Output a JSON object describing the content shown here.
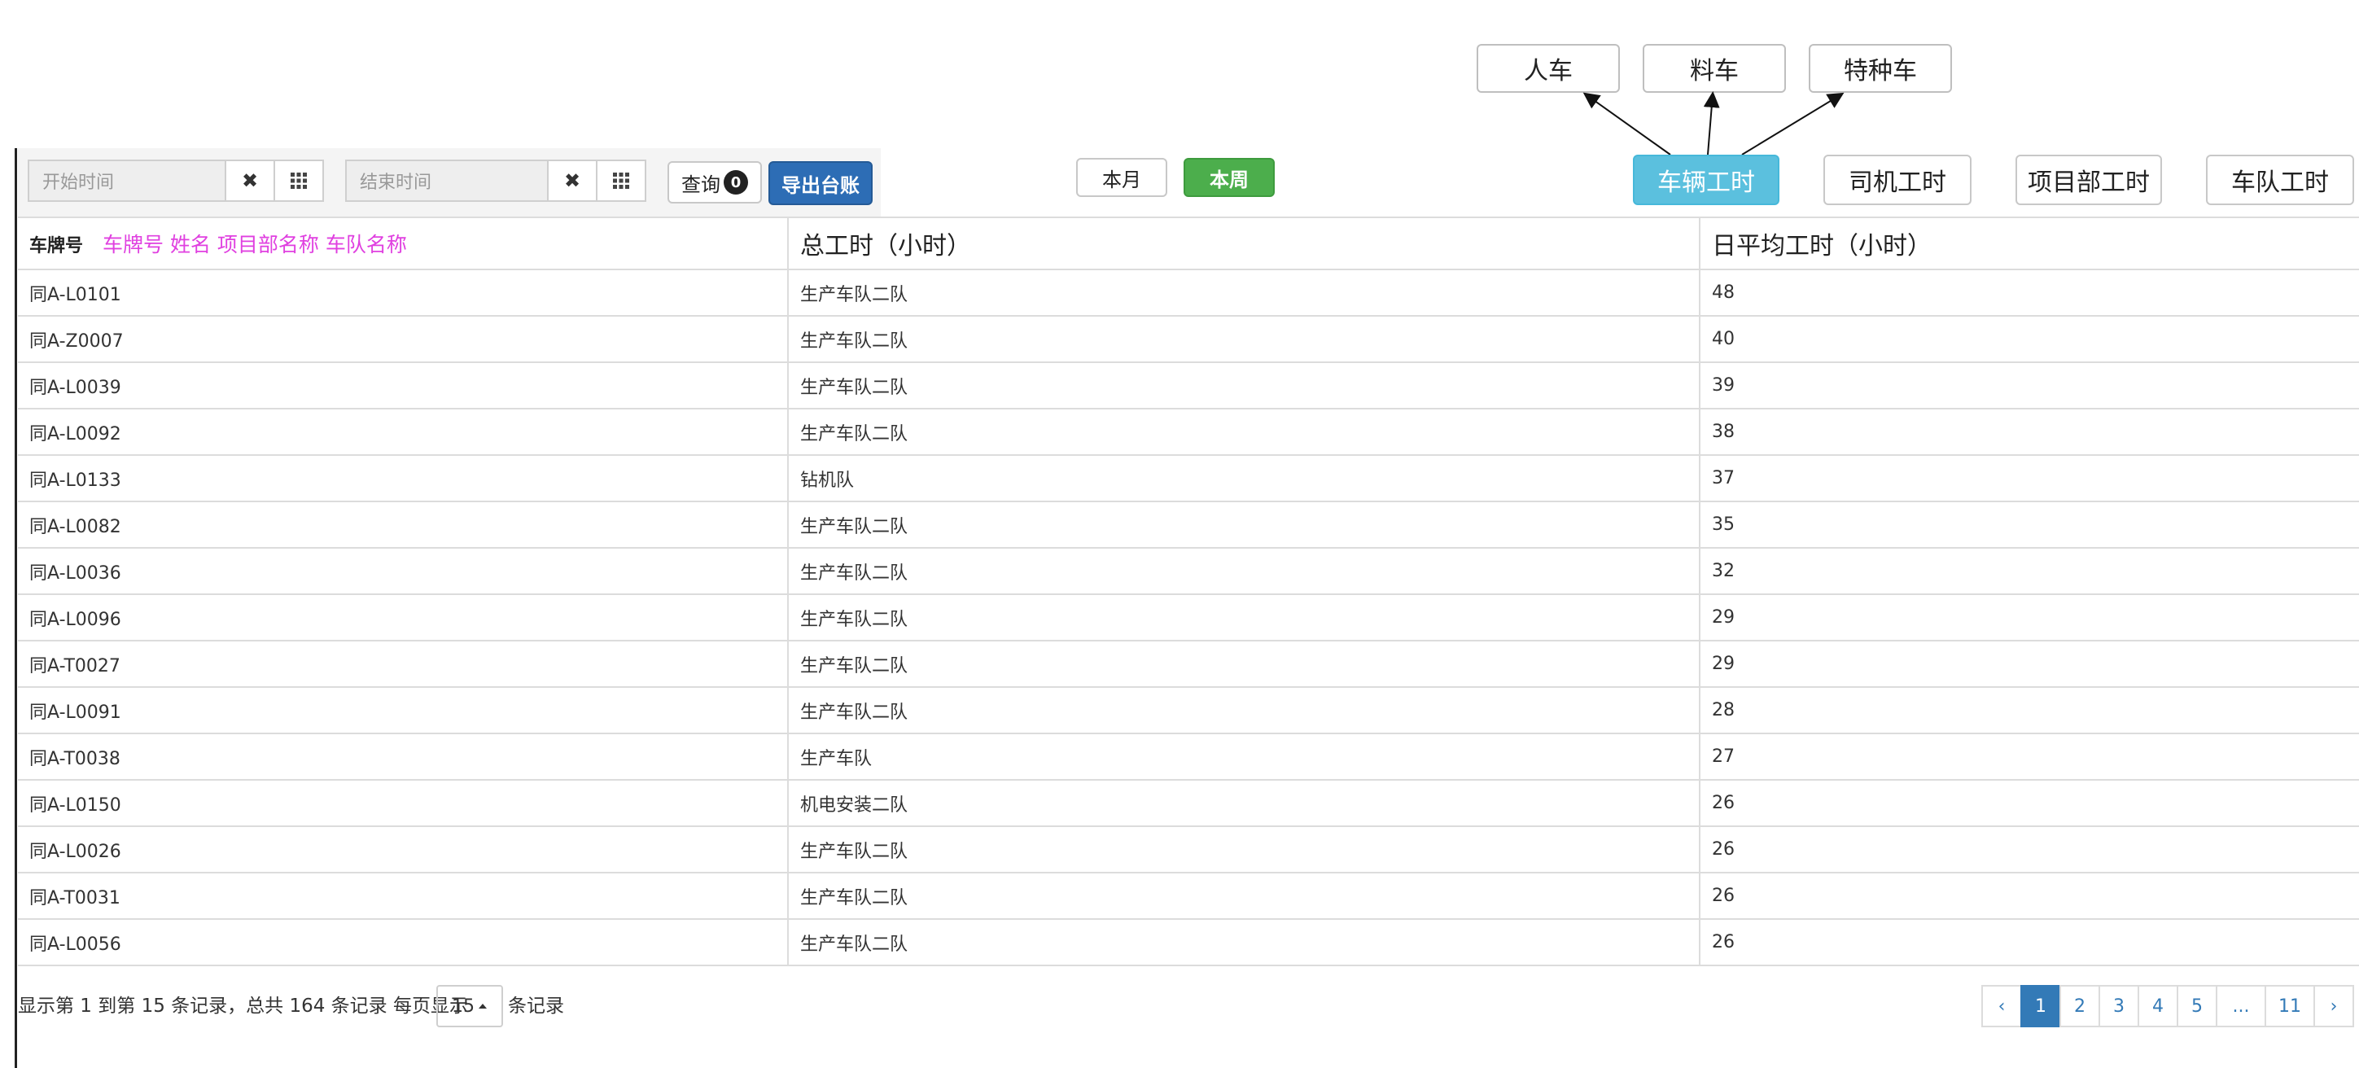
{
  "annotations": {
    "labels": [
      "人车",
      "料车",
      "特种车"
    ]
  },
  "toolbar": {
    "start_placeholder": "开始时间",
    "end_placeholder": "结束时间",
    "clear_icon": "✖",
    "calendar_icon": "grid-icon",
    "query_label": "查询",
    "query_count": "0",
    "export_label": "导出台账",
    "this_month": "本月",
    "this_week": "本周"
  },
  "tabs": {
    "vehicle": "车辆工时",
    "driver": "司机工时",
    "project": "项目部工时",
    "team": "车队工时"
  },
  "table": {
    "header_key": "车牌号",
    "header_hint": "车牌号 姓名 项目部名称 车队名称",
    "col2": "总工时（小时）",
    "col3": "日平均工时（小时）",
    "rows": [
      {
        "plate": "同A-L0101",
        "team": "生产车队二队",
        "hours": "48"
      },
      {
        "plate": "同A-Z0007",
        "team": "生产车队二队",
        "hours": "40"
      },
      {
        "plate": "同A-L0039",
        "team": "生产车队二队",
        "hours": "39"
      },
      {
        "plate": "同A-L0092",
        "team": "生产车队二队",
        "hours": "38"
      },
      {
        "plate": "同A-L0133",
        "team": "钻机队",
        "hours": "37"
      },
      {
        "plate": "同A-L0082",
        "team": "生产车队二队",
        "hours": "35"
      },
      {
        "plate": "同A-L0036",
        "team": "生产车队二队",
        "hours": "32"
      },
      {
        "plate": "同A-L0096",
        "team": "生产车队二队",
        "hours": "29"
      },
      {
        "plate": "同A-T0027",
        "team": "生产车队二队",
        "hours": "29"
      },
      {
        "plate": "同A-L0091",
        "team": "生产车队二队",
        "hours": "28"
      },
      {
        "plate": "同A-T0038",
        "team": "生产车队",
        "hours": "27"
      },
      {
        "plate": "同A-L0150",
        "team": "机电安装二队",
        "hours": "26"
      },
      {
        "plate": "同A-L0026",
        "team": "生产车队二队",
        "hours": "26"
      },
      {
        "plate": "同A-T0031",
        "team": "生产车队二队",
        "hours": "26"
      },
      {
        "plate": "同A-L0056",
        "team": "生产车队二队",
        "hours": "26"
      }
    ]
  },
  "footer": {
    "summary": "显示第 1 到第 15 条记录，总共 164 条记录 每页显示",
    "page_size": "15",
    "suffix": "条记录",
    "pages": [
      "‹",
      "1",
      "2",
      "3",
      "4",
      "5",
      "...",
      "11",
      "›"
    ],
    "active_page": "1"
  },
  "colors": {
    "primary": "#337ab7",
    "export": "#2d6db5",
    "success": "#4cae4c",
    "info": "#5bc0de",
    "hint": "#e040e0"
  }
}
